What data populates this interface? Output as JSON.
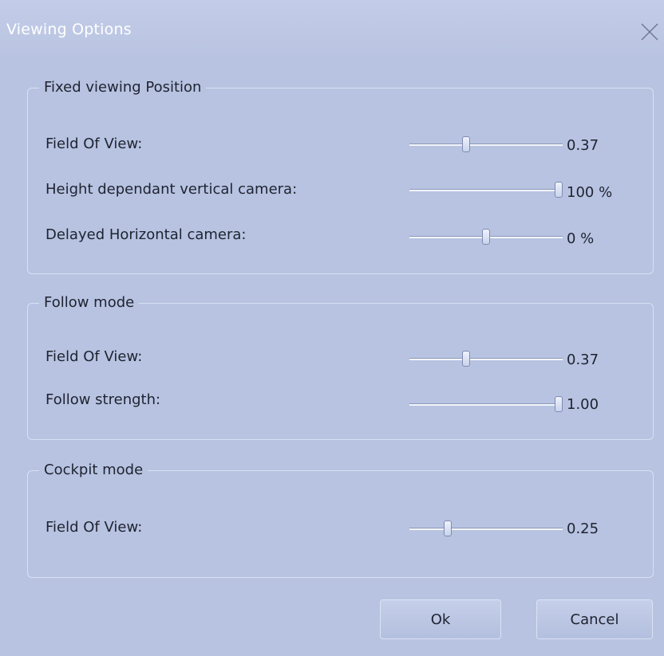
{
  "window": {
    "title": "Viewing Options"
  },
  "groups": [
    {
      "title": "Fixed viewing Position",
      "rows": [
        {
          "label": "Field Of View:",
          "value": "0.37",
          "slider_fraction": 0.37
        },
        {
          "label": "Height dependant vertical camera:",
          "value": "100 %",
          "slider_fraction": 1.0
        },
        {
          "label": "Delayed Horizontal camera:",
          "value": "0 %",
          "slider_fraction": 0.5
        }
      ]
    },
    {
      "title": "Follow mode",
      "rows": [
        {
          "label": "Field Of View:",
          "value": "0.37",
          "slider_fraction": 0.37
        },
        {
          "label": "Follow strength:",
          "value": "1.00",
          "slider_fraction": 1.0
        }
      ]
    },
    {
      "title": "Cockpit mode",
      "rows": [
        {
          "label": "Field Of View:",
          "value": "0.25",
          "slider_fraction": 0.25
        }
      ]
    }
  ],
  "buttons": {
    "ok_label": "Ok",
    "cancel_label": "Cancel"
  }
}
